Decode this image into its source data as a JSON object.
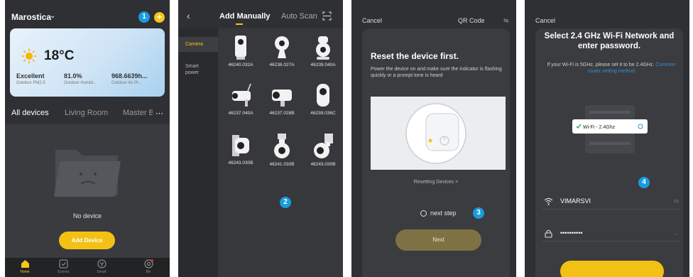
{
  "markers": [
    "1",
    "2",
    "3",
    "4"
  ],
  "screen1": {
    "home_name": "Marostica",
    "add_icon": "plus-icon",
    "weather": {
      "temperature": "18°C",
      "stats": [
        {
          "value": "Excellent",
          "label": "Outdoor PM2.5"
        },
        {
          "value": "81.0%",
          "label": "Outdoor Humid..."
        },
        {
          "value": "968.6639h...",
          "label": "Outdoor Air Pr..."
        }
      ]
    },
    "room_tabs": [
      "All devices",
      "Living Room",
      "Master B"
    ],
    "empty_text": "No device",
    "add_device": "Add Device",
    "tabbar": [
      "Home",
      "Scenes",
      "Smart",
      "Me"
    ]
  },
  "screen2": {
    "tab_manual": "Add Manually",
    "tab_scan": "Auto Scan",
    "categories": [
      "Camera",
      "Smart power"
    ],
    "devices": [
      "46240.032A",
      "46238.027A",
      "46239.040A",
      "46237.040A",
      "46237.028B",
      "46239.036C",
      "46243.030B",
      "46241.030B",
      "46243.030B"
    ]
  },
  "screen3": {
    "cancel": "Cancel",
    "qr_code": "QR Code",
    "title": "Reset the device first.",
    "description": "Power the device on and make sure the indicator is flashing quickly or a prompt tone is heard",
    "resetting_link": "Resetting Devices >",
    "next_step": "next step",
    "next": "Next"
  },
  "screen4": {
    "cancel": "Cancel",
    "title": "Select 2.4 GHz Wi-Fi Network and enter password.",
    "note": "If your Wi-Fi is 5GHz, please set it to be 2.4GHz.",
    "note_link": "Common router setting method",
    "illus_wifi_label": "Wi-Fi - 2.4Ghz",
    "network": "VIMARSVI",
    "password": "••••••••••"
  },
  "colors": {
    "accent": "#f5c518",
    "marker": "#1a9be0",
    "panel_bg": "#2f3033"
  }
}
